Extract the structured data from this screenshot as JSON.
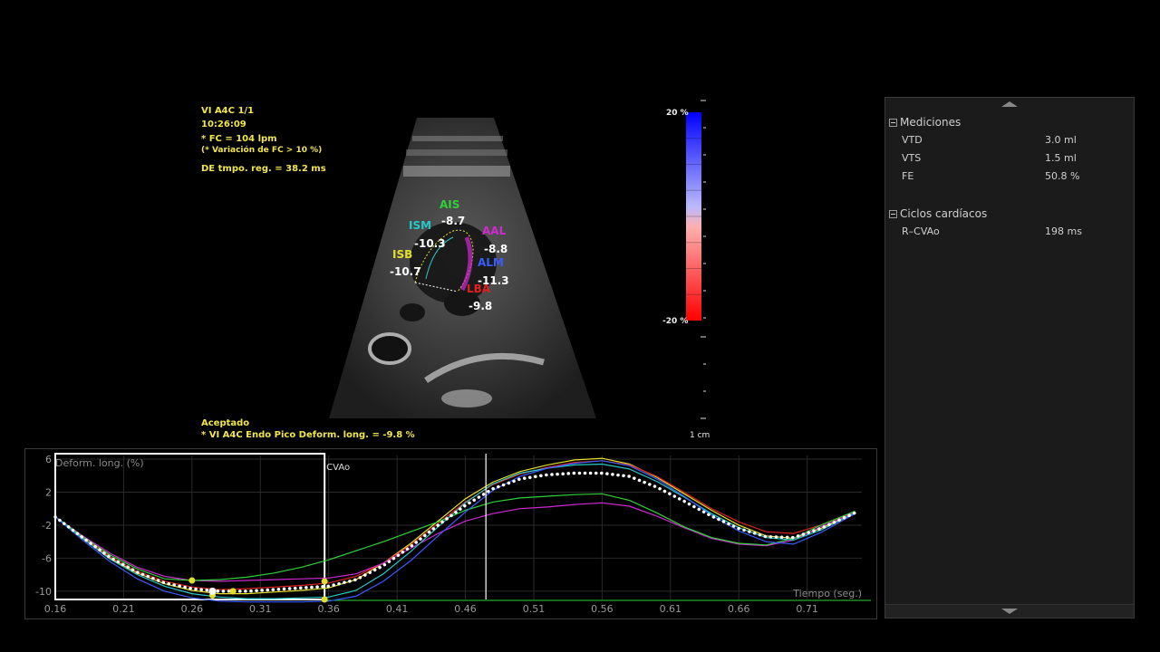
{
  "overlay": {
    "view": "VI A4C 1/1",
    "time": "10:26:09",
    "hr": "* FC = 104 lpm",
    "hr_var": "(* Variación de FC > 10 %)",
    "de": "DE tmpo. reg. = 38.2 ms",
    "accepted": "Aceptado",
    "peak": "* VI A4C Endo Pico Deform. long. = -9.8 %"
  },
  "segments": [
    {
      "name": "AIS",
      "value": "-8.7",
      "color": "#2fd13a"
    },
    {
      "name": "ISM",
      "value": "-10.3",
      "color": "#27c8c8"
    },
    {
      "name": "AAL",
      "value": "-8.8",
      "color": "#d02ad0"
    },
    {
      "name": "ISB",
      "value": "-10.7",
      "color": "#e4e02a"
    },
    {
      "name": "ALM",
      "value": "-11.3",
      "color": "#3a5cff"
    },
    {
      "name": "LBA",
      "value": "-9.8",
      "color": "#e02020"
    }
  ],
  "colorscale": {
    "top": "20 %",
    "bottom": "-20 %",
    "unit": "1 cm"
  },
  "panel": {
    "measurements_title": "Mediciones",
    "measurements": [
      {
        "label": "VTD",
        "value": "3.0 ml"
      },
      {
        "label": "VTS",
        "value": "1.5 ml"
      },
      {
        "label": "FE",
        "value": "50.8 %"
      }
    ],
    "cycles_title": "Ciclos cardíacos",
    "cycles": [
      {
        "label": "R–CVAo",
        "value": "198 ms"
      }
    ]
  },
  "chart_data": {
    "type": "line",
    "ylabel": "Deform. long. (%)",
    "xlabel": "Tiempo (seg.)",
    "marker_label": "CVAo",
    "xlim": [
      0.16,
      0.75
    ],
    "ylim": [
      -11,
      6
    ],
    "xticks": [
      "0.16",
      "0.21",
      "0.26",
      "0.31",
      "0.36",
      "0.41",
      "0.46",
      "0.51",
      "0.56",
      "0.61",
      "0.66",
      "0.71"
    ],
    "yticks": [
      "6",
      "2",
      "-2",
      "-6",
      "-10"
    ],
    "x": [
      0.16,
      0.18,
      0.2,
      0.22,
      0.24,
      0.26,
      0.28,
      0.3,
      0.32,
      0.34,
      0.36,
      0.38,
      0.4,
      0.42,
      0.44,
      0.46,
      0.48,
      0.5,
      0.52,
      0.54,
      0.56,
      0.58,
      0.6,
      0.62,
      0.64,
      0.66,
      0.68,
      0.7,
      0.72,
      0.745
    ],
    "series": [
      {
        "color": "#e4e02a",
        "values": [
          -1,
          -3.6,
          -6,
          -7.8,
          -9.1,
          -9.9,
          -10.3,
          -10.3,
          -10.1,
          -9.9,
          -9.6,
          -8.6,
          -6.6,
          -4.2,
          -1.5,
          1.2,
          3.2,
          4.5,
          5.3,
          5.9,
          6.1,
          5.4,
          3.8,
          1.8,
          -0.2,
          -2.0,
          -3.3,
          -3.6,
          -2.4,
          -0.5
        ]
      },
      {
        "color": "#e02020",
        "values": [
          -1,
          -3.5,
          -5.8,
          -7.6,
          -8.8,
          -9.5,
          -9.8,
          -9.7,
          -9.5,
          -9.3,
          -9.0,
          -8.2,
          -6.6,
          -4.4,
          -1.8,
          0.8,
          2.9,
          4.2,
          5.0,
          5.6,
          5.8,
          5.3,
          3.9,
          2.0,
          0.0,
          -1.6,
          -2.8,
          -3.0,
          -2.0,
          -0.4
        ]
      },
      {
        "color": "#d02ad0",
        "values": [
          -1,
          -3.3,
          -5.4,
          -7.1,
          -8.2,
          -8.7,
          -8.8,
          -8.7,
          -8.6,
          -8.5,
          -8.4,
          -7.9,
          -6.6,
          -4.8,
          -3.0,
          -1.5,
          -0.6,
          0.0,
          0.2,
          0.5,
          0.7,
          0.3,
          -0.9,
          -2.3,
          -3.6,
          -4.3,
          -4.5,
          -3.8,
          -2.2,
          -0.5
        ]
      },
      {
        "color": "#2fd13a",
        "values": [
          -1,
          -3.4,
          -5.6,
          -7.3,
          -8.5,
          -8.7,
          -8.6,
          -8.3,
          -7.8,
          -7.1,
          -6.2,
          -5.1,
          -4.0,
          -2.8,
          -1.6,
          -0.2,
          0.8,
          1.3,
          1.5,
          1.7,
          1.8,
          1.0,
          -0.5,
          -2.2,
          -3.5,
          -4.2,
          -4.4,
          -3.6,
          -2.0,
          -0.3
        ]
      },
      {
        "color": "#27c8c8",
        "values": [
          -1,
          -3.6,
          -6.1,
          -8.0,
          -9.4,
          -10.3,
          -10.7,
          -10.9,
          -10.9,
          -10.8,
          -10.7,
          -9.9,
          -7.9,
          -5.2,
          -2.2,
          0.7,
          3.0,
          4.3,
          4.9,
          5.3,
          5.4,
          4.8,
          3.3,
          1.4,
          -0.6,
          -2.3,
          -3.5,
          -3.8,
          -2.6,
          -0.5
        ]
      },
      {
        "color": "#3a5cff",
        "values": [
          -1,
          -3.8,
          -6.4,
          -8.5,
          -10.0,
          -10.8,
          -11.2,
          -11.3,
          -11.3,
          -11.3,
          -11.2,
          -10.6,
          -8.8,
          -6.3,
          -3.3,
          -0.4,
          2.2,
          3.9,
          4.9,
          5.5,
          5.8,
          5.2,
          3.6,
          1.5,
          -0.8,
          -2.7,
          -4.0,
          -4.3,
          -2.9,
          -0.6
        ]
      },
      {
        "color": "#ffffff",
        "dotted": true,
        "values": [
          -1,
          -3.5,
          -5.9,
          -7.7,
          -9.0,
          -9.7,
          -10.0,
          -10.0,
          -9.8,
          -9.6,
          -9.4,
          -8.6,
          -6.9,
          -4.6,
          -2.0,
          0.4,
          2.4,
          3.6,
          4.1,
          4.3,
          4.3,
          3.9,
          2.6,
          0.9,
          -0.9,
          -2.4,
          -3.4,
          -3.5,
          -2.4,
          -0.5
        ]
      }
    ],
    "vertical_marker_x": 0.475,
    "roi_end_x": 0.357,
    "peak_points": [
      {
        "x": 0.26,
        "y": -8.7,
        "color": "#e4e02a"
      },
      {
        "x": 0.275,
        "y": -10.5,
        "color": "#e4e02a"
      },
      {
        "x": 0.275,
        "y": -10.0,
        "color": "#ffffff"
      },
      {
        "x": 0.29,
        "y": -10.0,
        "color": "#e4e02a"
      },
      {
        "x": 0.357,
        "y": -8.8,
        "color": "#e4e02a"
      },
      {
        "x": 0.357,
        "y": -11.0,
        "color": "#e4e02a"
      }
    ]
  }
}
